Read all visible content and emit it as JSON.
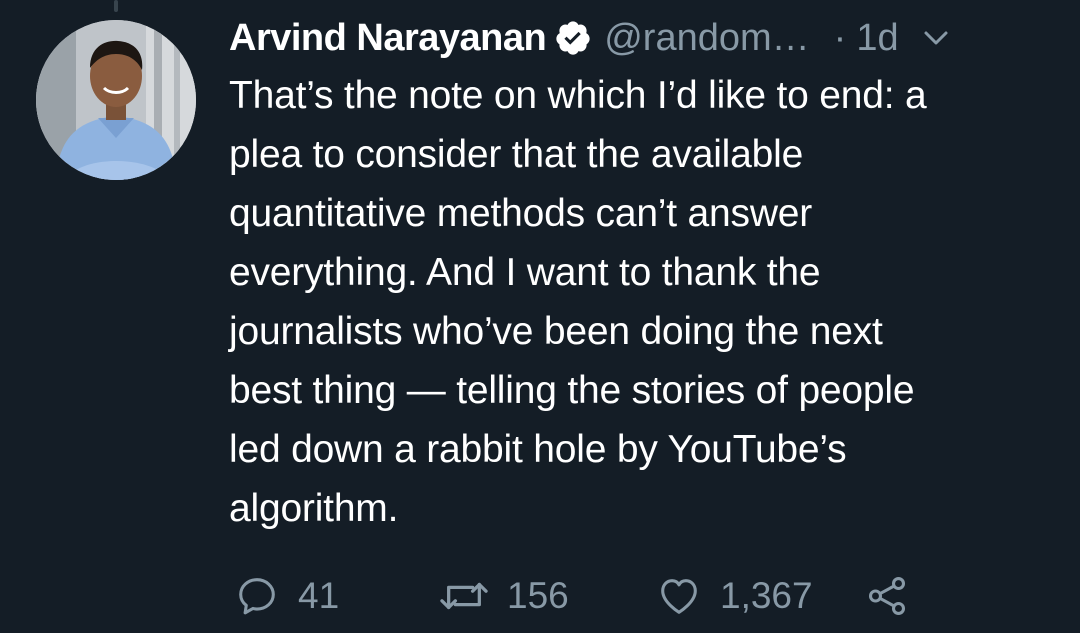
{
  "tweet": {
    "author_name": "Arvind Narayanan",
    "handle": "@random…",
    "separator": "·",
    "time": "1d",
    "text": "That’s the note on which I’d like to end: a\nplea to consider that the available\nquantitative methods can’t answer\neverything. And I want to thank the\njournalists who’ve been doing the next\nbest thing — telling the stories of people\nled down a rabbit hole by YouTube’s\nalgorithm.",
    "verified": true
  },
  "actions": {
    "reply_count": "41",
    "retweet_count": "156",
    "like_count": "1,367"
  },
  "icons": {
    "verified": "verified-badge-icon",
    "menu": "chevron-down-icon",
    "reply": "reply-icon",
    "retweet": "retweet-icon",
    "like": "heart-icon",
    "share": "share-icon"
  },
  "colors": {
    "background": "#141d26",
    "text": "#ffffff",
    "secondary": "#8899a6",
    "thread_line": "#38444d"
  }
}
